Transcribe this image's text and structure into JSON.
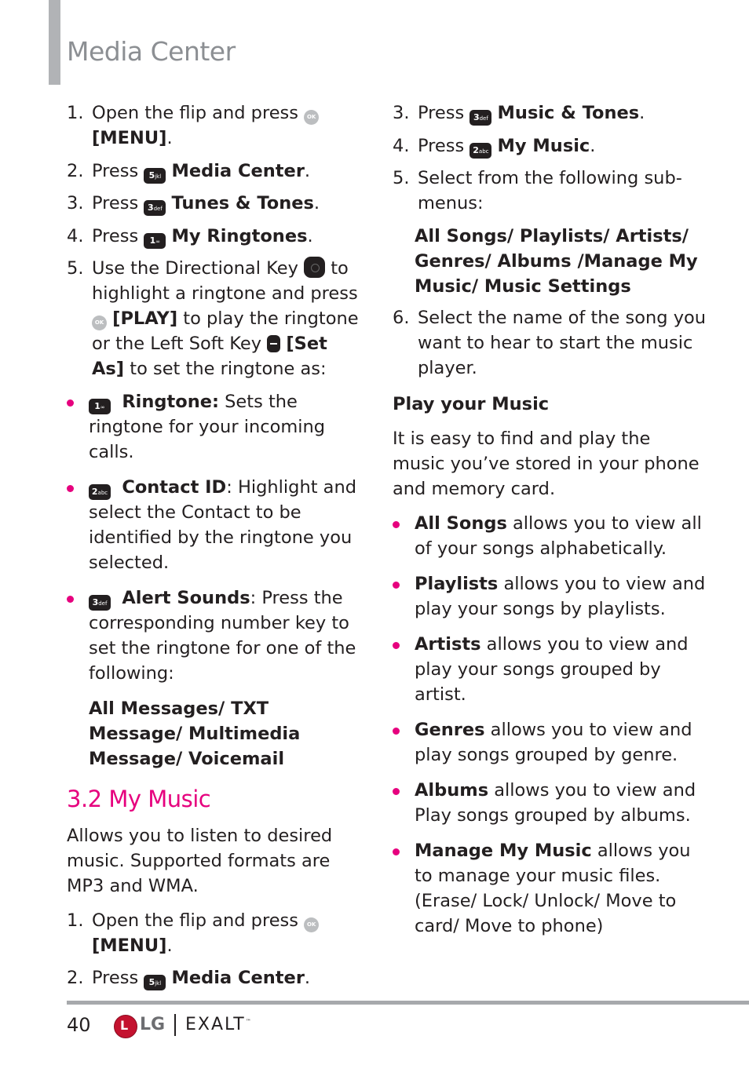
{
  "header": {
    "title": "Media Center"
  },
  "left_column": {
    "steps_a": [
      {
        "num": "1.",
        "text_before": "Open the flip and press",
        "icon": "ok-key",
        "icon_label": "OK",
        "bold": "[MENU]",
        "text_after": "."
      },
      {
        "num": "2.",
        "text_before": "Press",
        "icon": "key-5",
        "icon_label": "5",
        "icon_sub": "jkl",
        "bold": "Media Center",
        "text_after": "."
      },
      {
        "num": "3.",
        "text_before": "Press",
        "icon": "key-3",
        "icon_label": "3",
        "icon_sub": "def",
        "bold": "Tunes & Tones",
        "text_after": "."
      },
      {
        "num": "4.",
        "text_before": "Press",
        "icon": "key-1",
        "icon_label": "1",
        "icon_sub": "voicemail",
        "bold": "My Ringtones",
        "text_after": "."
      }
    ],
    "step5": {
      "num": "5.",
      "t1": "Use the Directional Key",
      "t2": "to highlight a ringtone and press",
      "play": "[PLAY]",
      "t3": "to play the ringtone or the Left Soft Key",
      "setas": "[Set As]",
      "t4": "to set the ringtone as:"
    },
    "bullets": [
      {
        "icon_label": "1",
        "icon_sub": "voicemail",
        "bold": "Ringtone:",
        "text": "Sets the ringtone for your incoming calls."
      },
      {
        "icon_label": "2",
        "icon_sub": "abc",
        "bold": "Contact ID",
        "text": ": Highlight and select the Contact to be identified by the ringtone you selected."
      },
      {
        "icon_label": "3",
        "icon_sub": "def",
        "bold": "Alert Sounds",
        "text": ": Press the corresponding number key to set the ringtone for one of the following:"
      }
    ],
    "alert_options": "All Messages/ TXT Message/ Multimedia Message/ Voicemail",
    "section_heading": "3.2 My Music",
    "section_intro": "Allows you to listen to desired music. Supported formats are MP3 and WMA.",
    "steps_b": [
      {
        "num": "1.",
        "text_before": "Open the flip and press",
        "icon_label": "OK",
        "bold": "[MENU]",
        "text_after": "."
      },
      {
        "num": "2.",
        "text_before": "Press",
        "icon_label": "5",
        "icon_sub": "jkl",
        "bold": "Media Center",
        "text_after": "."
      }
    ]
  },
  "right_column": {
    "steps": [
      {
        "num": "3.",
        "text_before": "Press",
        "icon_label": "3",
        "icon_sub": "def",
        "bold": "Music & Tones",
        "text_after": "."
      },
      {
        "num": "4.",
        "text_before": "Press",
        "icon_label": "2",
        "icon_sub": "abc",
        "bold": "My Music",
        "text_after": "."
      },
      {
        "num": "5.",
        "text": "Select from the following sub-menus:"
      }
    ],
    "submenus": "All Songs/ Playlists/ Artists/ Genres/ Albums /Manage My Music/ Music Settings",
    "step6": {
      "num": "6.",
      "text": "Select the name of the song you want to hear to start the music player."
    },
    "subheading": "Play your Music",
    "intro": "It is easy to find and play the music you’ve stored in your phone and memory card.",
    "bullets": [
      {
        "bold": "All Songs",
        "text": " allows you to view all of your songs alphabetically."
      },
      {
        "bold": "Playlists",
        "text": " allows you to view and play your songs by playlists."
      },
      {
        "bold": "Artists",
        "text": " allows you to view and play your songs grouped by artist."
      },
      {
        "bold": "Genres",
        "text": " allows you to view and play songs grouped by genre."
      },
      {
        "bold": "Albums",
        "text": " allows you to view and Play songs grouped by albums."
      },
      {
        "bold": "Manage My Music",
        "text": " allows you to manage your music files. (Erase/ Lock/ Unlock/ Move to card/ Move to phone)"
      }
    ]
  },
  "footer": {
    "page_number": "40",
    "logo_text": "LG",
    "product_name": "EXALT",
    "trademark": "™"
  },
  "colors": {
    "accent": "#e6007e",
    "title_gray": "#8c8f93",
    "bar_gray": "#b1b3b6",
    "text": "#231f20"
  }
}
